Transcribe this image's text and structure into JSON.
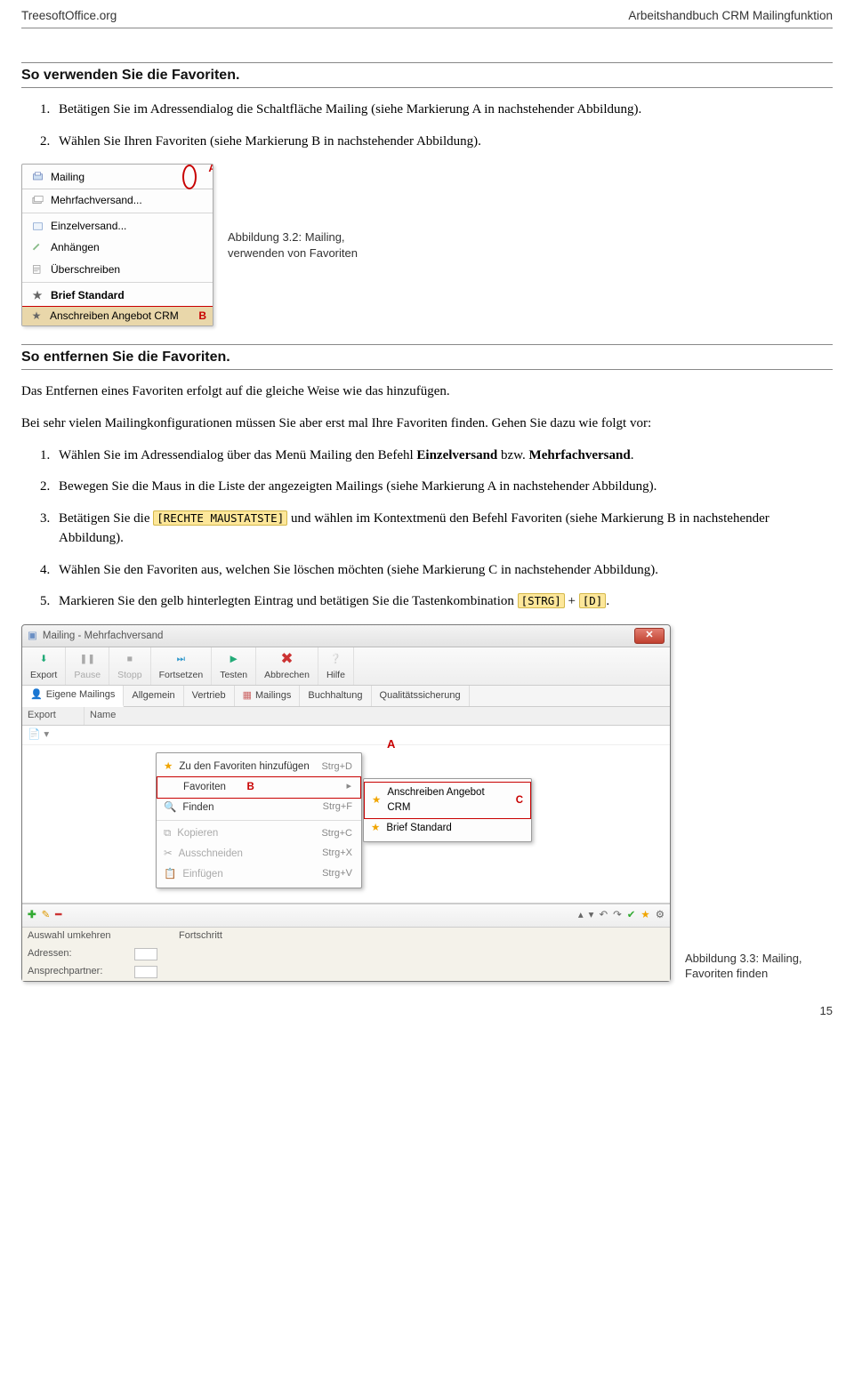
{
  "header": {
    "left": "TreesoftOffice.org",
    "right": "Arbeitshandbuch CRM Mailingfunktion"
  },
  "section1_title": "So verwenden Sie die Favoriten.",
  "steps1": [
    "Betätigen Sie im Adressendialog die Schaltfläche Mailing (siehe Markierung A in nachstehender Abbildung).",
    "Wählen Sie Ihren Favoriten (siehe Markierung B in nachstehender Abbildung)."
  ],
  "fig32": {
    "top_label": "Mailing",
    "marker_a": "A",
    "items": [
      "Mehrfachversand...",
      "Einzelversand...",
      "Anhängen",
      "Überschreiben",
      "Brief Standard",
      "Anschreiben Angebot CRM"
    ],
    "marker_b": "B",
    "caption": "Abbildung 3.2: Mailing, verwenden von Favoriten"
  },
  "section2_title": "So entfernen Sie die Favoriten.",
  "para1": "Das Entfernen eines Favoriten erfolgt auf die gleiche Weise wie das hinzufügen.",
  "para2": "Bei sehr vielen Mailingkonfigurationen müssen Sie aber erst mal Ihre Favoriten finden. Gehen Sie dazu wie folgt vor:",
  "steps2": {
    "s1_pre": "Wählen Sie im Adressendialog über das Menü Mailing den Befehl ",
    "s1_b1": "Einzelversand",
    "s1_mid": " bzw. ",
    "s1_b2": "Mehrfachversand",
    "s1_post": ".",
    "s2": "Bewegen Sie die Maus in die Liste der angezeigten Mailings (siehe Markierung A in nachstehender Abbildung).",
    "s3_pre": "Betätigen Sie die ",
    "s3_key": "[RECHTE MAUSTATSTE]",
    "s3_post": " und wählen im Kontextmenü den Befehl Favoriten (siehe Markierung B in nachstehender Abbildung).",
    "s4": "Wählen Sie den Favoriten aus, welchen Sie löschen möchten (siehe Markierung C in nachstehender Abbildung).",
    "s5_pre": "Markieren Sie den gelb hinterlegten Eintrag und betätigen Sie die Tastenkombination ",
    "s5_k1": "[STRG]",
    "s5_mid": " + ",
    "s5_k2": "[D]",
    "s5_post": "."
  },
  "fig33": {
    "title": "Mailing - Mehrfachversand",
    "toolbar": [
      "Export",
      "Pause",
      "Stopp",
      "Fortsetzen",
      "Testen",
      "Abbrechen",
      "Hilfe"
    ],
    "tabs": [
      "Eigene Mailings",
      "Allgemein",
      "Vertrieb",
      "Mailings",
      "Buchhaltung",
      "Qualitätssicherung"
    ],
    "cols": [
      "Export",
      "Name"
    ],
    "marker_a": "A",
    "ctx": {
      "add": {
        "label": "Zu den Favoriten hinzufügen",
        "kb": "Strg+D"
      },
      "fav": {
        "label": "Favoriten",
        "marker": "B"
      },
      "find": {
        "label": "Finden",
        "kb": "Strg+F"
      },
      "copy": {
        "label": "Kopieren",
        "kb": "Strg+C"
      },
      "cut": {
        "label": "Ausschneiden",
        "kb": "Strg+X"
      },
      "paste": {
        "label": "Einfügen",
        "kb": "Strg+V"
      }
    },
    "favpop": {
      "item1": "Anschreiben Angebot CRM",
      "item2": "Brief Standard",
      "marker": "C"
    },
    "status": {
      "row1": "Auswahl umkehren",
      "row1b": "Fortschritt",
      "row2": "Adressen:",
      "row3": "Ansprechpartner:"
    },
    "caption": "Abbildung 3.3: Mailing, Favoriten finden"
  },
  "page_no": "15"
}
